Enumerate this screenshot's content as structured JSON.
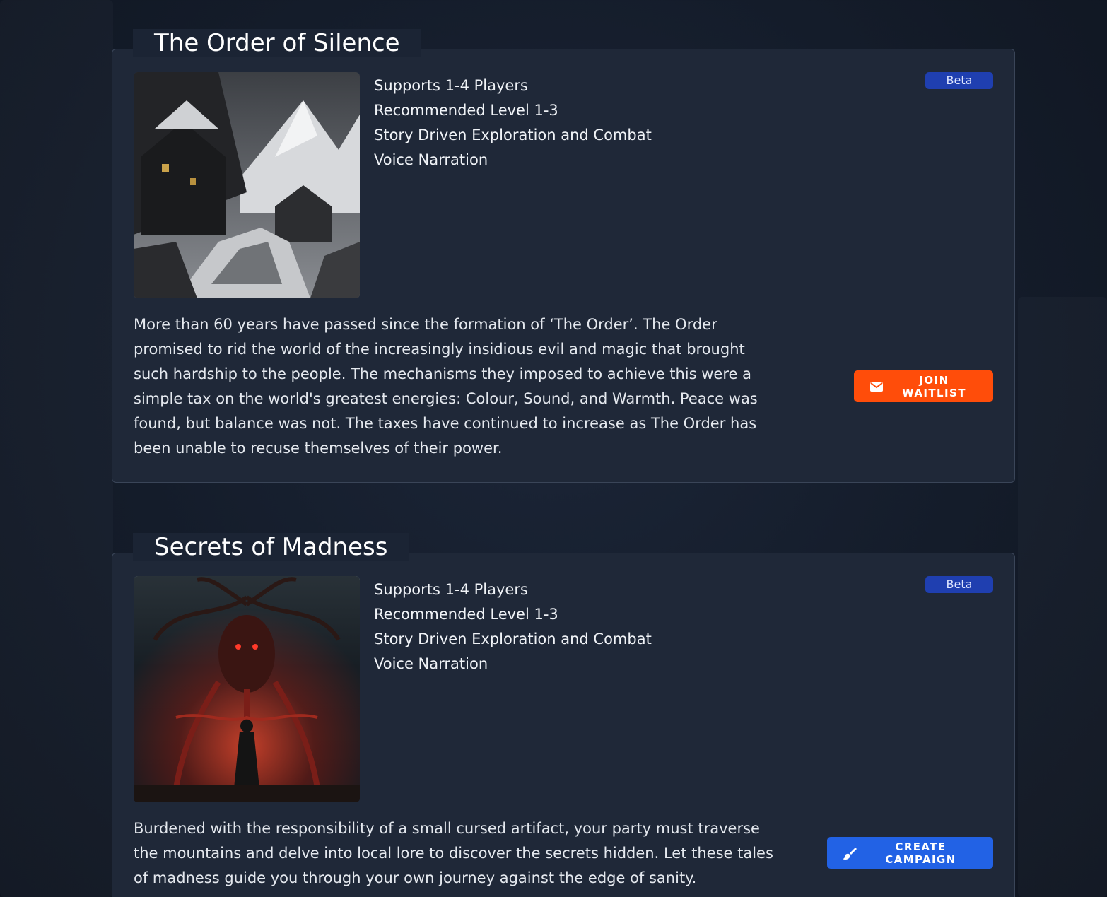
{
  "campaigns": [
    {
      "title": "The Order of Silence",
      "image": "snowy-village-cover",
      "features": [
        "Supports 1-4 Players",
        "Recommended Level 1-3",
        "Story Driven Exploration and Combat",
        "Voice Narration"
      ],
      "badge": "Beta",
      "description": "More than 60 years have passed since the formation of ‘The Order’. The Order promised to rid the world of the increasingly insidious evil and magic that brought such hardship to the people. The mechanisms they imposed to achieve this were a simple tax on the world's greatest energies: Colour, Sound, and Warmth. Peace was found, but balance was not. The taxes have continued to increase as The Order has been unable to recuse themselves of their power.",
      "action": {
        "label": "JOIN WAITLIST",
        "icon": "envelope-icon",
        "color": "#ff4d0a"
      }
    },
    {
      "title": "Secrets of Madness",
      "image": "tree-demon-cover",
      "features": [
        "Supports 1-4 Players",
        "Recommended Level 1-3",
        "Story Driven Exploration and Combat",
        "Voice Narration"
      ],
      "badge": "Beta",
      "description": "Burdened with the responsibility of a small cursed artifact, your party must traverse the mountains and delve into local lore to discover the secrets hidden. Let these tales of madness guide you through your own journey against the edge of sanity.",
      "action": {
        "label": "CREATE CAMPAIGN",
        "icon": "brush-icon",
        "color": "#2262e5"
      }
    }
  ],
  "colors": {
    "card_bg": "#1f2838",
    "card_border": "#3a4558",
    "badge_bg": "#1f3fb0"
  }
}
